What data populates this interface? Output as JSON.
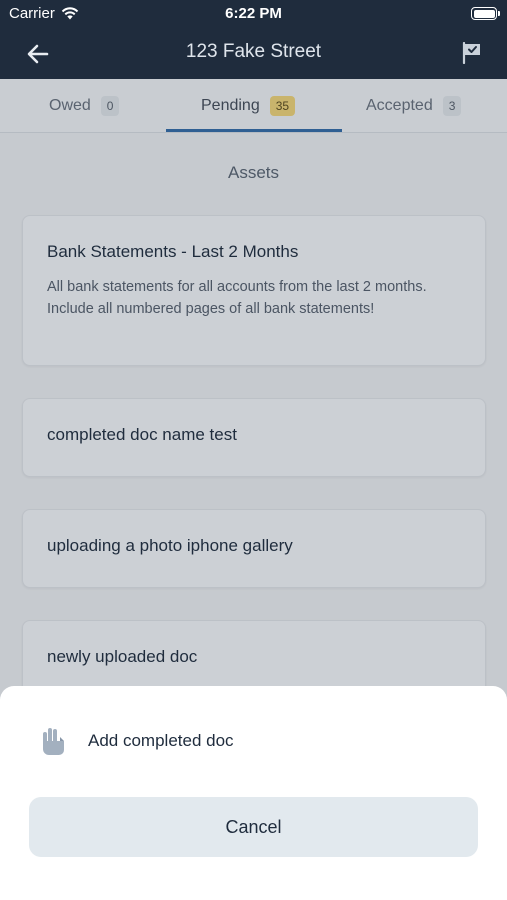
{
  "status_bar": {
    "carrier": "Carrier",
    "time": "6:22 PM"
  },
  "nav": {
    "title": "123 Fake Street",
    "back_icon": "arrow-left-icon",
    "flag_icon": "flag-icon"
  },
  "tabs": [
    {
      "label": "Owed",
      "count": "0"
    },
    {
      "label": "Pending",
      "count": "35",
      "active": true
    },
    {
      "label": "Accepted",
      "count": "3"
    }
  ],
  "section": {
    "title": "Assets"
  },
  "documents": [
    {
      "title": "Bank Statements - Last 2 Months",
      "description": "All bank statements for all accounts from the last 2 months. Include all numbered pages of all bank statements!"
    },
    {
      "title": "completed doc name test"
    },
    {
      "title": "uploading a photo iphone gallery"
    },
    {
      "title": "newly uploaded doc"
    }
  ],
  "action_sheet": {
    "action_label": "Add completed doc",
    "action_icon": "hand-paper-icon",
    "cancel_label": "Cancel"
  },
  "colors": {
    "nav_bg": "#1f2c3d",
    "tab_underline": "#2f5f93",
    "pending_badge": "#c9b46c"
  }
}
